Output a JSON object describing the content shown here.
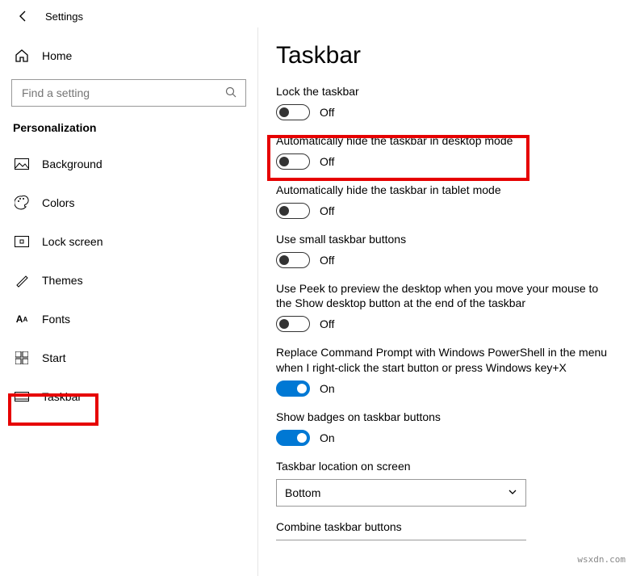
{
  "header": {
    "title": "Settings"
  },
  "sidebar": {
    "home": "Home",
    "search_placeholder": "Find a setting",
    "category": "Personalization",
    "items": [
      {
        "label": "Background"
      },
      {
        "label": "Colors"
      },
      {
        "label": "Lock screen"
      },
      {
        "label": "Themes"
      },
      {
        "label": "Fonts"
      },
      {
        "label": "Start"
      },
      {
        "label": "Taskbar"
      }
    ]
  },
  "main": {
    "title": "Taskbar",
    "settings": [
      {
        "label": "Lock the taskbar",
        "value": false,
        "state_text": "Off"
      },
      {
        "label": "Automatically hide the taskbar in desktop mode",
        "value": false,
        "state_text": "Off"
      },
      {
        "label": "Automatically hide the taskbar in tablet mode",
        "value": false,
        "state_text": "Off"
      },
      {
        "label": "Use small taskbar buttons",
        "value": false,
        "state_text": "Off"
      },
      {
        "label": "Use Peek to preview the desktop when you move your mouse to the Show desktop button at the end of the taskbar",
        "value": false,
        "state_text": "Off"
      },
      {
        "label": "Replace Command Prompt with Windows PowerShell in the menu when I right-click the start button or press Windows key+X",
        "value": true,
        "state_text": "On"
      },
      {
        "label": "Show badges on taskbar buttons",
        "value": true,
        "state_text": "On"
      }
    ],
    "location_label": "Taskbar location on screen",
    "location_value": "Bottom",
    "combine_label": "Combine taskbar buttons"
  },
  "watermark": "wsxdn.com"
}
